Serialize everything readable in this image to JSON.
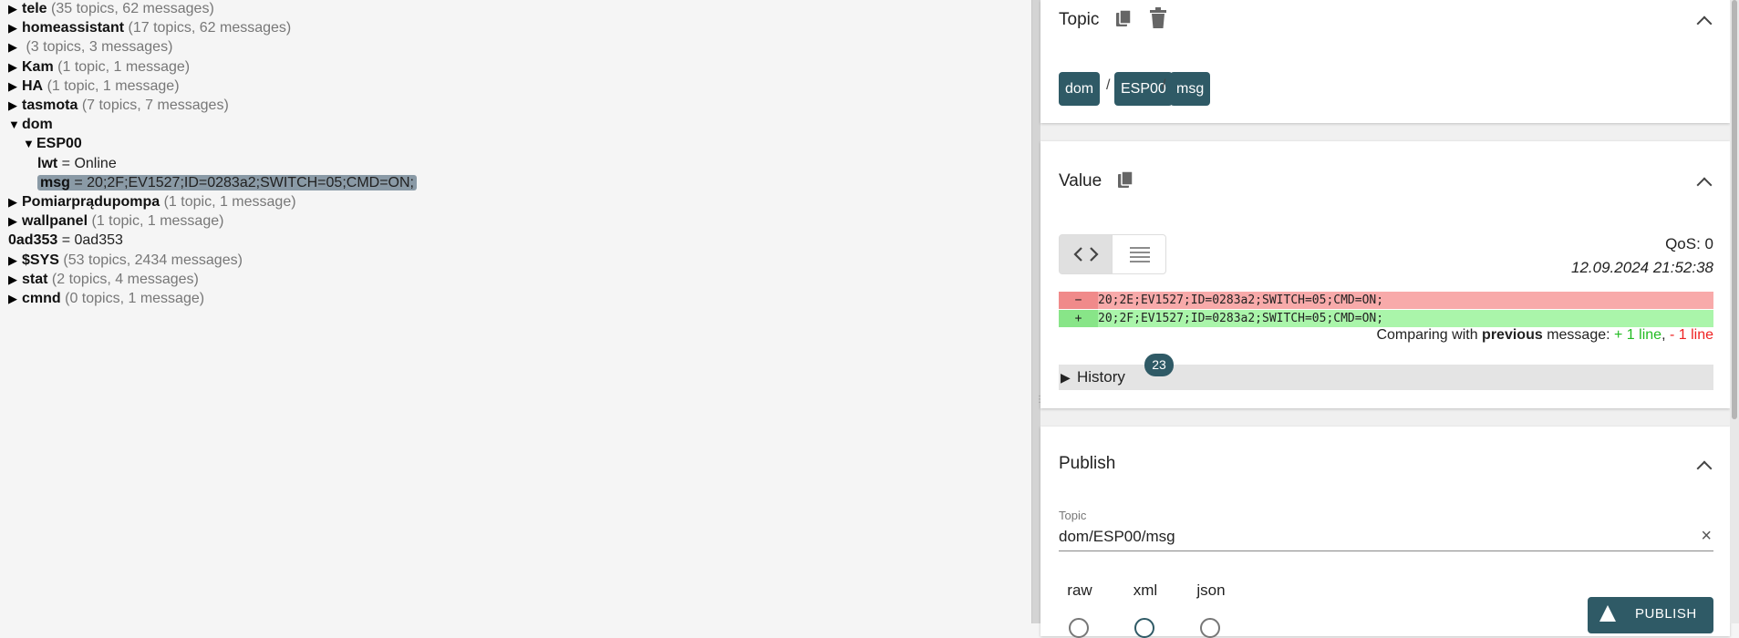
{
  "tree": [
    {
      "level": 0,
      "expanded": false,
      "name": "tele",
      "meta": "(35 topics, 62 messages)"
    },
    {
      "level": 0,
      "expanded": false,
      "name": "homeassistant",
      "meta": "(17 topics, 62 messages)"
    },
    {
      "level": 0,
      "expanded": false,
      "name": "",
      "meta": "(3 topics, 3 messages)"
    },
    {
      "level": 0,
      "expanded": false,
      "name": "Kam",
      "meta": "(1 topic, 1 message)"
    },
    {
      "level": 0,
      "expanded": false,
      "name": "HA",
      "meta": "(1 topic, 1 message)"
    },
    {
      "level": 0,
      "expanded": false,
      "name": "tasmota",
      "meta": "(7 topics, 7 messages)"
    },
    {
      "level": 0,
      "expanded": true,
      "name": "dom",
      "meta": ""
    },
    {
      "level": 1,
      "expanded": true,
      "name": "ESP00",
      "meta": ""
    },
    {
      "level": 2,
      "leaf": true,
      "name": "lwt",
      "value": "= Online"
    },
    {
      "level": 2,
      "leaf": true,
      "selected": true,
      "name": "msg",
      "value": "= 20;2F;EV1527;ID=0283a2;SWITCH=05;CMD=ON;"
    },
    {
      "level": 0,
      "expanded": false,
      "name": "Pomiarprądupompa",
      "meta": "(1 topic, 1 message)"
    },
    {
      "level": 0,
      "expanded": false,
      "name": "wallpanel",
      "meta": "(1 topic, 1 message)"
    },
    {
      "level": 0,
      "leaf": true,
      "name": "0ad353",
      "value": "= 0ad353"
    },
    {
      "level": 0,
      "expanded": false,
      "name": "$SYS",
      "meta": "(53 topics, 2434 messages)"
    },
    {
      "level": 0,
      "expanded": false,
      "name": "stat",
      "meta": "(2 topics, 4 messages)"
    },
    {
      "level": 0,
      "expanded": false,
      "name": "cmnd",
      "meta": "(0 topics, 1 message)"
    }
  ],
  "topic_card": {
    "title": "Topic",
    "breadcrumbs": [
      "dom",
      "ESP00",
      "msg"
    ],
    "separator": "/"
  },
  "value_card": {
    "title": "Value",
    "qos": "QoS: 0",
    "timestamp": "12.09.2024 21:52:38",
    "diff": [
      {
        "type": "del",
        "sign": "−",
        "text": "20;2E;EV1527;ID=0283a2;SWITCH=05;CMD=ON;"
      },
      {
        "type": "add",
        "sign": "+",
        "text": "20;2F;EV1527;ID=0283a2;SWITCH=05;CMD=ON;"
      }
    ],
    "compare_prefix": "Comparing with",
    "compare_bold": "previous",
    "compare_suffix": "message:",
    "compare_added": "+ 1 line",
    "compare_sep": ",",
    "compare_removed": "- 1 line",
    "history_label": "History",
    "history_count": "23"
  },
  "publish_card": {
    "title": "Publish",
    "topic_label": "Topic",
    "topic_value": "dom/ESP00/msg",
    "formats": [
      "raw",
      "xml",
      "json"
    ],
    "selected_format": "xml",
    "publish_button": "PUBLISH"
  },
  "colors": {
    "accent": "#2f5a66",
    "selected_row": "#8a9aa6",
    "diff_removed": "#f8aaaa",
    "diff_added": "#aaf5aa",
    "added_text": "#22bb22",
    "removed_text": "#ee2222"
  }
}
